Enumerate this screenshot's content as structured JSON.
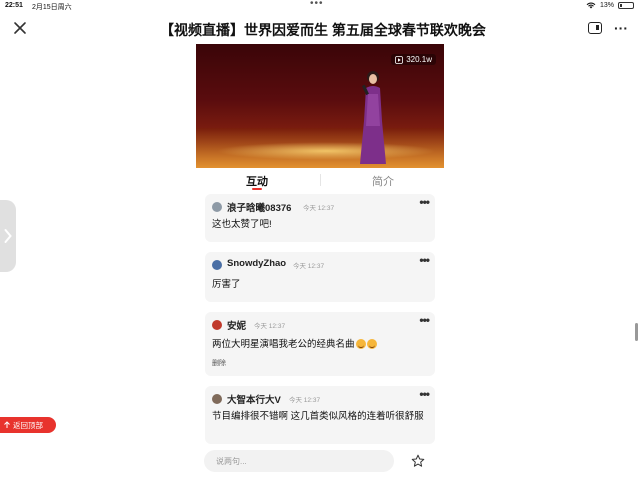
{
  "status": {
    "time": "22:51",
    "date": "2月15日周六",
    "battery": "13%"
  },
  "header": {
    "title": "【视频直播】世界因爱而生 第五届全球春节联欢晚会"
  },
  "video": {
    "view_count": "320.1w"
  },
  "tabs": [
    {
      "label": "互动",
      "active": true
    },
    {
      "label": "简介",
      "active": false
    }
  ],
  "comments": [
    {
      "user": "浪子晗曦08376",
      "time": "今天 12:37",
      "text": "这也太赞了吧!",
      "avatar_color": "#8e9aa6"
    },
    {
      "user": "SnowdyZhao",
      "time": "今天 12:37",
      "text": "厉害了",
      "avatar_color": "#4a6fa5"
    },
    {
      "user": "安妮",
      "time": "今天 12:37",
      "text": "两位大明星演唱我老公的经典名曲",
      "emoji_count": 2,
      "action": "删除",
      "avatar_color": "#c0392b"
    },
    {
      "user": "大智本行大V",
      "time": "今天 12:37",
      "text": "节目编排很不错啊 这几首类似风格的连着听很舒服",
      "avatar_color": "#7f6a5a"
    }
  ],
  "input": {
    "placeholder": "说两句..."
  },
  "back_to_top": "返回顶部",
  "icons": [
    "close-icon",
    "split-view-icon",
    "more-icon",
    "wifi-icon",
    "battery-icon",
    "play-icon",
    "star-icon",
    "arrow-up-icon",
    "chevron-right-icon"
  ],
  "colors": {
    "accent": "#e8332d",
    "card_bg": "#f5f5f5"
  }
}
